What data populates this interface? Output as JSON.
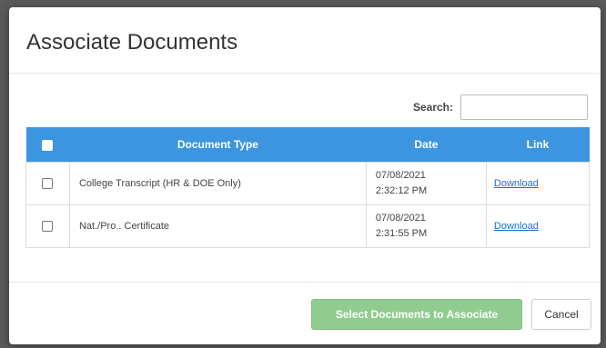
{
  "modal": {
    "title": "Associate Documents"
  },
  "search": {
    "label": "Search:",
    "value": "",
    "placeholder": ""
  },
  "table": {
    "headers": {
      "type": "Document Type",
      "date": "Date",
      "link": "Link"
    },
    "rows": [
      {
        "type": "College Transcript (HR & DOE Only)",
        "date": "07/08/2021",
        "time": "2:32:12 PM",
        "link": "Download",
        "checked": false
      },
      {
        "type": "Nat./Pro.. Certificate",
        "date": "07/08/2021",
        "time": "2:31:55 PM",
        "link": "Download",
        "checked": false
      }
    ]
  },
  "footer": {
    "associate_label": "Select Documents to Associate",
    "cancel_label": "Cancel"
  },
  "colors": {
    "header_blue": "#3c95de",
    "associate_green": "#7dc47d",
    "link_blue": "#1a6fc9"
  }
}
